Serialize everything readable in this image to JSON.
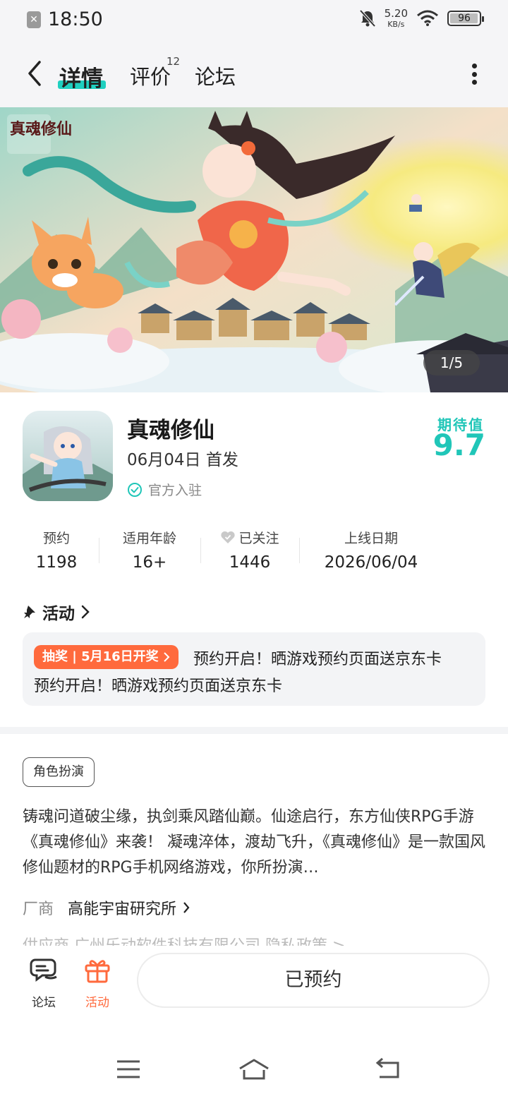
{
  "status_bar": {
    "time": "18:50",
    "net_speed": "5.20",
    "net_unit": "KB/s",
    "battery": "96"
  },
  "header": {
    "tabs": [
      {
        "label": "详情",
        "active": true
      },
      {
        "label": "评价",
        "badge": "12"
      },
      {
        "label": "论坛"
      }
    ]
  },
  "banner": {
    "counter": "1/5",
    "logo_text": "真魂修仙"
  },
  "game": {
    "title": "真魂修仙",
    "release": "06月04日 首发",
    "official": "官方入驻",
    "expect_label": "期待值",
    "expect_value": "9.7"
  },
  "stats": [
    {
      "label": "预约",
      "value": "1198"
    },
    {
      "label": "适用年龄",
      "value": "16+"
    },
    {
      "label": "已关注",
      "value": "1446"
    },
    {
      "label": "上线日期",
      "value": "2026/06/04"
    }
  ],
  "activity": {
    "title": "活动",
    "tag": "抽奖 | 5月16日开奖",
    "line1": "预约开启！晒游戏预约页面送京东卡",
    "line2": "预约开启！晒游戏预约页面送京东卡"
  },
  "details": {
    "genre": "角色扮演",
    "description": "铸魂问道破尘缘，执剑乘风踏仙巅。仙途启行，东方仙侠RPG手游《真魂修仙》来袭！ 凝魂淬体，渡劫飞升，《真魂修仙》是一款国风修仙题材的RPG手机网络游戏，你所扮演…",
    "vendor_label": "厂商",
    "vendor_name": "高能宇宙研究所",
    "publisher_partial": "供应商  广州乐动软件科技有限公司  隐私政策 >"
  },
  "actionbar": {
    "forum_label": "论坛",
    "activity_label": "活动",
    "reserve_label": "已预约"
  },
  "colors": {
    "accent": "#20c6b8",
    "orange": "#ff6a3d",
    "header_bg": "#f5f5f7"
  }
}
